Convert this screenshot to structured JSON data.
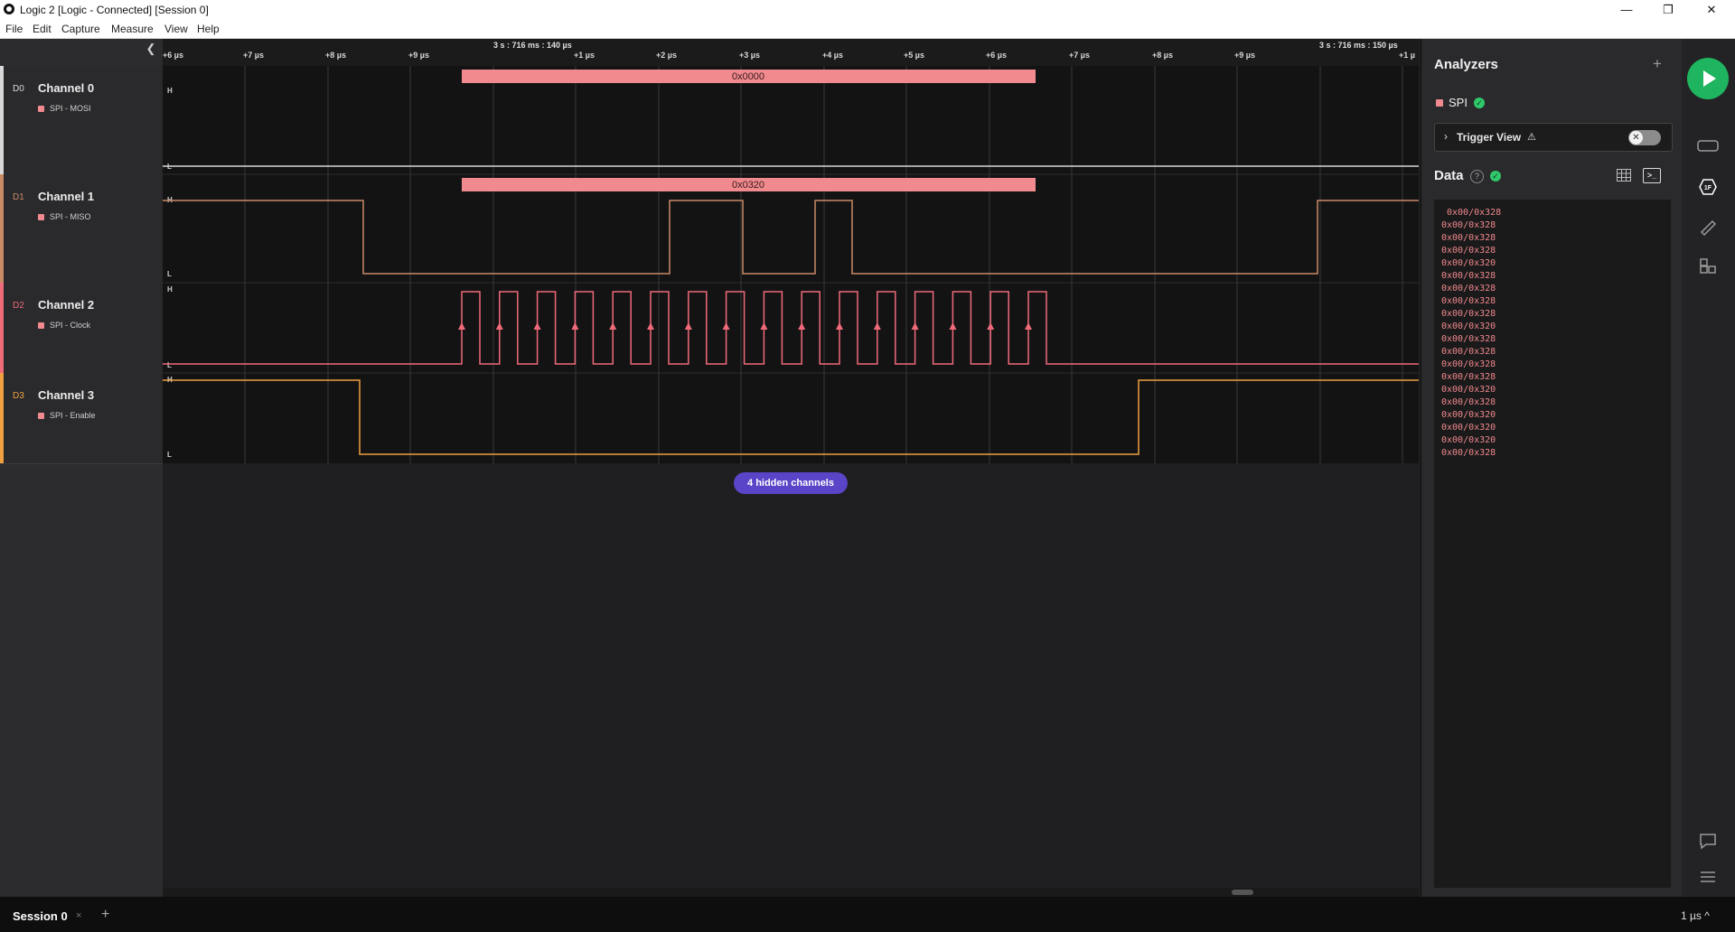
{
  "window": {
    "title": "Logic 2 [Logic - Connected] [Session 0]",
    "minimize": "—",
    "restore": "❐",
    "close": "✕"
  },
  "menu": [
    "File",
    "Edit",
    "Capture",
    "Measure",
    "View",
    "Help"
  ],
  "channels": [
    {
      "id": "D0",
      "name": "Channel 0",
      "analyzer": "SPI - MOSI",
      "color": "#d8d8d8",
      "high": "H",
      "low": "L"
    },
    {
      "id": "D1",
      "name": "Channel 1",
      "analyzer": "SPI - MISO",
      "color": "#c98a66",
      "high": "H",
      "low": "L"
    },
    {
      "id": "D2",
      "name": "Channel 2",
      "analyzer": "SPI - Clock",
      "color": "#f06a7a",
      "high": "H",
      "low": "L"
    },
    {
      "id": "D3",
      "name": "Channel 3",
      "analyzer": "SPI - Enable",
      "color": "#f0a040",
      "high": "H",
      "low": "L"
    }
  ],
  "ruler": {
    "ticks": [
      "+6 µs",
      "+7 µs",
      "+8 µs",
      "+9 µs",
      "+1 µs",
      "+2 µs",
      "+3 µs",
      "+4 µs",
      "+5 µs",
      "+6 µs",
      "+7 µs",
      "+8 µs",
      "+9 µs",
      "+1 µ"
    ],
    "timestamps": [
      "3 s : 716 ms : 140 µs",
      "3 s : 716 ms : 150 µs"
    ]
  },
  "decoded": {
    "mosi": "0x0000",
    "miso": "0x0320"
  },
  "hidden_channels": "4 hidden channels",
  "panel": {
    "analyzers_title": "Analyzers",
    "add": "+",
    "analyzer_name": "SPI",
    "trigger_label": "Trigger View",
    "trigger_warning": "⚠",
    "data_title": "Data",
    "data_help": "?",
    "data_rows": [
      "0x00/0x328",
      "0x00/0x328",
      "0x00/0x328",
      "0x00/0x328",
      "0x00/0x320",
      "0x00/0x328",
      "0x00/0x328",
      "0x00/0x328",
      "0x00/0x328",
      "0x00/0x320",
      "0x00/0x328",
      "0x00/0x328",
      "0x00/0x328",
      "0x00/0x328",
      "0x00/0x320",
      "0x00/0x328",
      "0x00/0x320",
      "0x00/0x320",
      "0x00/0x320",
      "0x00/0x328"
    ]
  },
  "session": {
    "tab": "Session 0",
    "close": "×",
    "add": "+",
    "time_scale": "1 µs ^"
  },
  "colors": {
    "accent_purple": "#5a45c8",
    "run_green": "#1fb45f",
    "decode_fill": "#f08a8e"
  }
}
